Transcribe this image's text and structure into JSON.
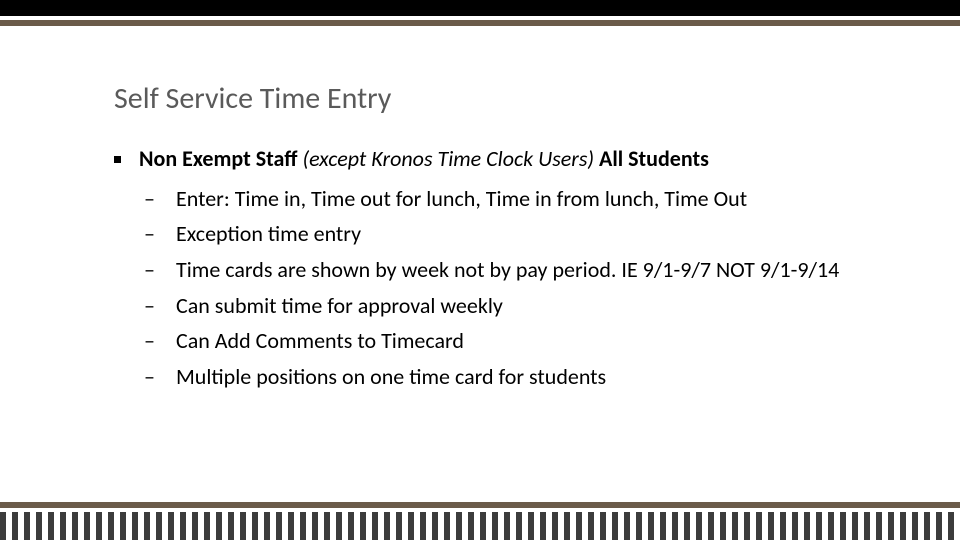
{
  "title": "Self Service Time Entry",
  "main": {
    "part1": "Non Exempt Staff ",
    "part2": "(except Kronos Time Clock Users) ",
    "part3": "All Students"
  },
  "subs": [
    "Enter: Time in, Time out for lunch, Time in from lunch, Time Out",
    "Exception time entry",
    "Time cards are shown by week not by pay period.  IE 9/1-9/7 NOT 9/1-9/14",
    "Can submit time for approval weekly",
    "Can Add Comments to Timecard",
    "Multiple positions on one time card for students"
  ]
}
